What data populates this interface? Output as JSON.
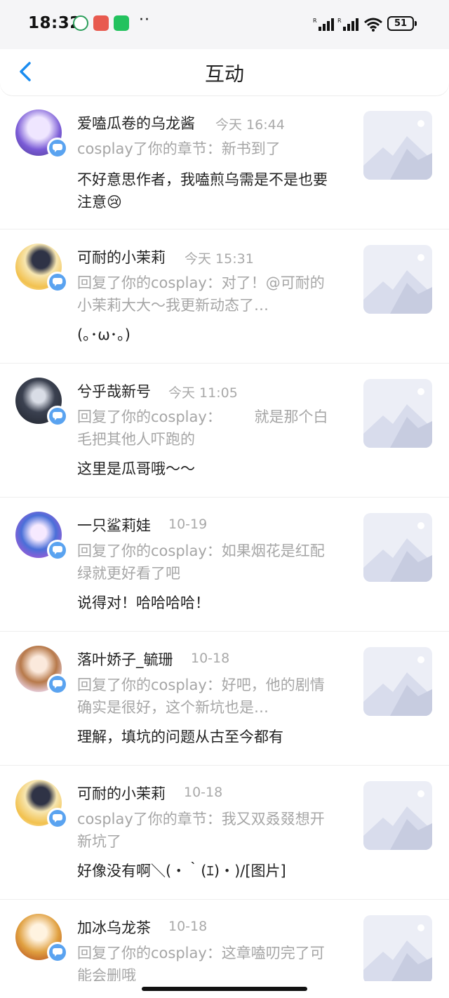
{
  "status_bar": {
    "time": "18:32",
    "dots": "··",
    "battery": "51",
    "signal_mark": "R"
  },
  "nav": {
    "title": "互动"
  },
  "items": [
    {
      "name": "爱嗑瓜卷的乌龙酱",
      "time": "今天 16:44",
      "quote": "cosplay了你的章节：新书到了",
      "reply": "不好意思作者，我嗑煎乌需是不是也要注意😢",
      "avatar_color": "#7a5bd6"
    },
    {
      "name": "可耐的小茉莉",
      "time": "今天 15:31",
      "quote": "回复了你的cosplay：对了！@可耐的小茉莉大大～我更新动态了…",
      "reply": "(｡･ω･｡)",
      "avatar_color": "#f2c14e"
    },
    {
      "name": "兮乎哉新号",
      "time": "今天 11:05",
      "quote": "回复了你的cosplay：       就是那个白毛把其他人吓跑的",
      "reply": "这里是瓜哥哦～～",
      "avatar_color": "#3b4150"
    },
    {
      "name": "一只鲨莉娃",
      "time": "10-19",
      "quote": "回复了你的cosplay：如果烟花是红配绿就更好看了吧",
      "reply": "说得对！哈哈哈哈！",
      "avatar_color": "#4a6fd8"
    },
    {
      "name": "落叶娇子_毓珊",
      "time": "10-18",
      "quote": "回复了你的cosplay：好吧，他的剧情确实是很好，这个新坑也是…",
      "reply": "理解，填坑的问题从古至今都有",
      "avatar_color": "#b7794a"
    },
    {
      "name": "可耐的小茉莉",
      "time": "10-18",
      "quote": "cosplay了你的章节：我又双叒叕想开新坑了",
      "reply": "好像没有啊＼(・｀(ｴ)・)/[图片]",
      "avatar_color": "#f2c14e"
    },
    {
      "name": "加冰乌龙茶",
      "time": "10-18",
      "quote": "回复了你的cosplay：这章嗑叨完了可能会删哦",
      "reply": "",
      "avatar_color": "#e0a040"
    }
  ],
  "icons": {
    "back": "chevron-left-icon",
    "badge": "comment-bubble-icon",
    "thumb": "image-placeholder-icon"
  },
  "colors": {
    "accent": "#1a8cf0",
    "badge": "#5aa3f0",
    "muted_text": "#a6a6a6"
  }
}
